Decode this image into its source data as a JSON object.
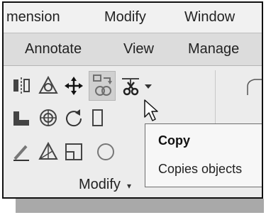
{
  "menubar": {
    "items": [
      "mension",
      "Modify",
      "Window"
    ]
  },
  "tabs": {
    "items": [
      "Annotate",
      "View",
      "Manage"
    ]
  },
  "ribbon": {
    "panel_title": "Modify",
    "panel_chevron": "▾",
    "tools": [
      {
        "icon": "mirror-icon"
      },
      {
        "icon": "array-icon"
      },
      {
        "icon": "move-icon"
      },
      {
        "icon": "copy-icon",
        "state": "hovered"
      },
      {
        "icon": "trim-icon"
      },
      {
        "icon": "dropdown-icon"
      },
      {
        "icon": "stretch-icon"
      },
      {
        "icon": "offset-icon"
      },
      {
        "icon": "rotate-icon"
      },
      {
        "icon": "erase-icon"
      },
      {
        "icon": "scale-icon"
      },
      {
        "icon": "rectangle-icon"
      },
      {
        "icon": "circle-icon"
      }
    ]
  },
  "tooltip": {
    "title": "Copy",
    "description": "Copies objects"
  },
  "colors": {
    "copy_icon_accent": "#6f6f6f",
    "hover_background": "#d0d0d0",
    "tooltip_border": "#6e6e6e"
  }
}
